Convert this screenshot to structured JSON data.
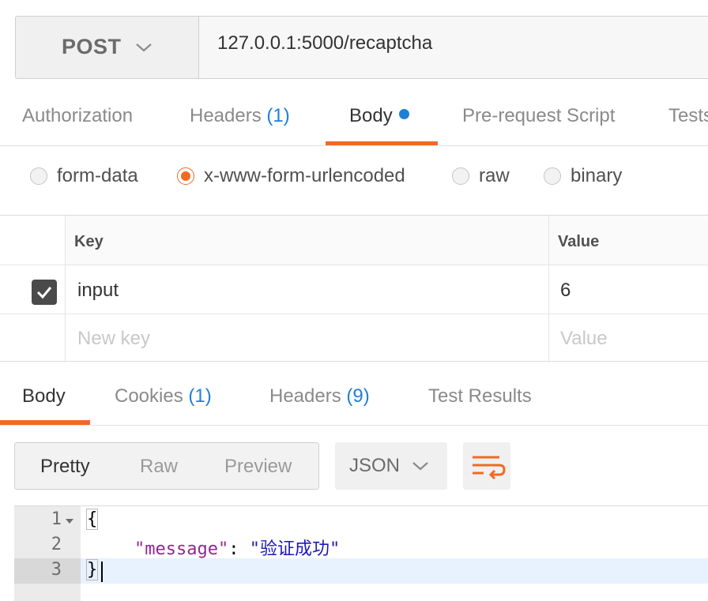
{
  "request": {
    "method": "POST",
    "url": "127.0.0.1:5000/recaptcha",
    "tabs": [
      {
        "label": "Authorization",
        "count": ""
      },
      {
        "label": "Headers",
        "count": "(1)"
      },
      {
        "label": "Body",
        "count": ""
      },
      {
        "label": "Pre-request Script",
        "count": ""
      },
      {
        "label": "Tests",
        "count": ""
      }
    ],
    "active_tab": "Body",
    "body_types": [
      "form-data",
      "x-www-form-urlencoded",
      "raw",
      "binary"
    ],
    "selected_body_type": "x-www-form-urlencoded",
    "table": {
      "headers": [
        "Key",
        "Value"
      ],
      "rows": [
        {
          "checked": true,
          "key": "input",
          "value": "6"
        }
      ],
      "new_key_placeholder": "New key",
      "new_value_placeholder": "Value"
    }
  },
  "response": {
    "tabs": [
      {
        "label": "Body",
        "count": ""
      },
      {
        "label": "Cookies",
        "count": "(1)"
      },
      {
        "label": "Headers",
        "count": "(9)"
      },
      {
        "label": "Test Results",
        "count": ""
      }
    ],
    "active_tab": "Body",
    "views": [
      "Pretty",
      "Raw",
      "Preview"
    ],
    "active_view": "Pretty",
    "format": "JSON",
    "line_numbers": [
      "1",
      "2",
      "3"
    ],
    "code": {
      "open": "{",
      "key": "\"message\"",
      "colon": ": ",
      "value": "\"验证成功\"",
      "close": "}"
    }
  },
  "colors": {
    "accent": "#f06a24",
    "link": "#1f7fd6",
    "json_key": "#92278f",
    "json_string": "#1c1ab2"
  }
}
